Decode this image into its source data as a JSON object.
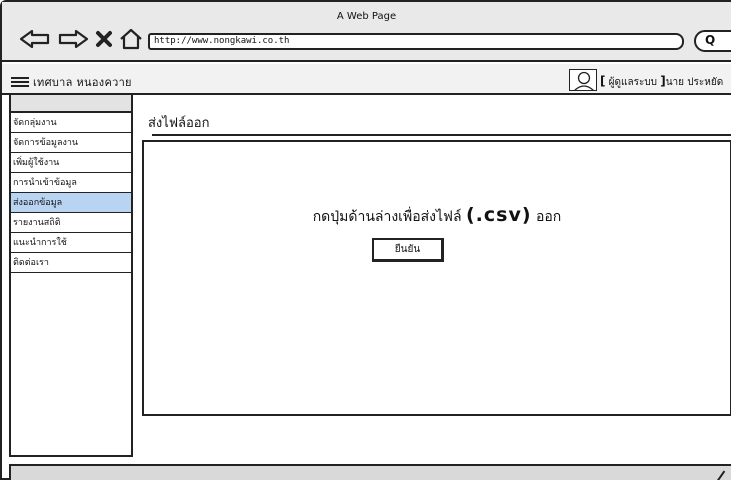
{
  "window": {
    "title": "A Web Page",
    "url": "http://www.nongkawi.co.th",
    "search_glyph": "Q"
  },
  "header": {
    "brand": "เทศบาล หนองควาย",
    "user_bracket_open": "[",
    "user_role": " ผู้ดูแลระบบ ",
    "user_bracket_close": "]",
    "user_name": "นาย ประหยัด"
  },
  "sidebar": {
    "items": [
      {
        "label": "จัดกลุ่มงาน"
      },
      {
        "label": "จัดการข้อมูลงาน"
      },
      {
        "label": "เพิ่มผู้ใช้งาน"
      },
      {
        "label": "การนำเข้าข้อมูล"
      },
      {
        "label": "ส่งออกข้อมูล"
      },
      {
        "label": "รายงานสถิติ"
      },
      {
        "label": "แนะนำการใช้"
      },
      {
        "label": "ติดต่อเรา"
      }
    ],
    "active_index": 4
  },
  "main": {
    "title": "ส่งไฟล์ออก",
    "message_prefix": "กดปุ่มด้านล่างเพื่อส่งไฟล์ ",
    "message_file_type": "(.csv)",
    "message_suffix": " ออก",
    "confirm_label": "ยืนยัน"
  },
  "colors": {
    "active_item": "#b9d3f3",
    "titlebar": "#e9e9e9",
    "footer": "#d9d9d9"
  },
  "icons": [
    "back-arrow-icon",
    "forward-arrow-icon",
    "close-icon",
    "home-icon",
    "search-icon",
    "menu-icon",
    "user-avatar-icon"
  ]
}
